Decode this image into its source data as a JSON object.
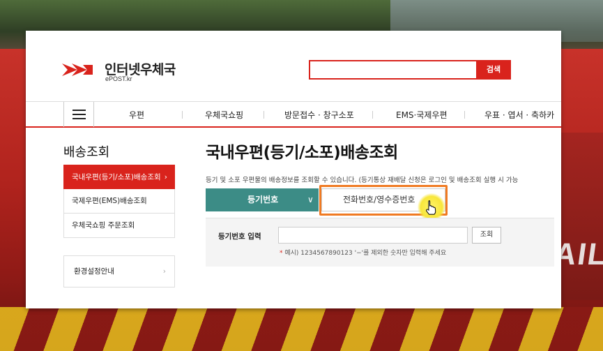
{
  "logo": {
    "name": "인터넷우체국",
    "domain": "ePOST.kr"
  },
  "search": {
    "value": "",
    "button": "검색"
  },
  "nav": {
    "menu_icon": "hamburger-icon",
    "items": [
      "우편",
      "우체국쇼핑",
      "방문접수 · 창구소포",
      "EMS·국제우편",
      "우표 · 엽서 · 축하카"
    ]
  },
  "sidebar": {
    "title": "배송조회",
    "items": [
      {
        "label": "국내우편(등기/소포)배송조회",
        "active": true,
        "chevron": "›"
      },
      {
        "label": "국제우편(EMS)배송조회",
        "active": false
      },
      {
        "label": "우체국쇼핑 주문조회",
        "active": false
      }
    ],
    "settings": {
      "label": "환경설정안내",
      "chevron": "›"
    }
  },
  "main": {
    "title": "국내우편(등기/소포)배송조회",
    "description": "등기 및 소포 우편물의 배송정보를 조회할 수 있습니다. (등기통상 재배달 신청은 로그인 및 배송조회 실행 시 가능",
    "tabs": [
      {
        "label": "등기번호",
        "chevron": "∨",
        "active": true
      },
      {
        "label": "전화번호/영수증번호",
        "active": false
      }
    ],
    "form": {
      "label": "등기번호 입력",
      "input_value": "",
      "button": "조회",
      "hint_star": "*",
      "hint": "예시) 1234567890123 '−'를 제외한 숫자만 입력해 주세요"
    }
  },
  "background": {
    "letters": "AIL"
  },
  "colors": {
    "brand_red": "#d9231c",
    "teal": "#3c8c86",
    "highlight_orange": "#f07a22"
  }
}
